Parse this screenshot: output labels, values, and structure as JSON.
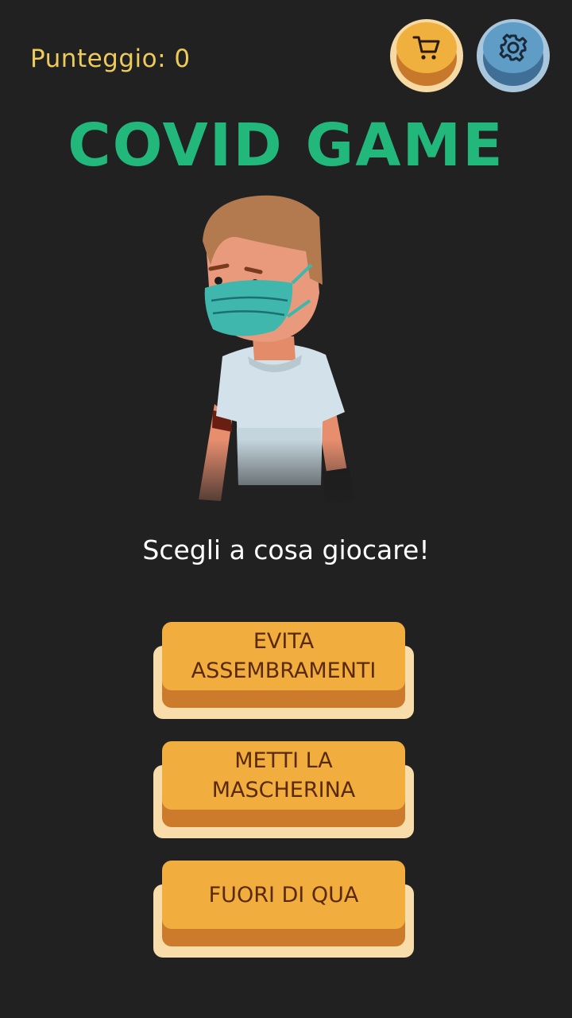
{
  "hud": {
    "score_text": "Punteggio: 0",
    "shop_icon": "cart-icon",
    "settings_icon": "gear-icon"
  },
  "title": "COVID GAME",
  "subtitle": "Scegli a cosa giocare!",
  "menu": {
    "buttons": [
      {
        "label_line1": "EVITA",
        "label_line2": "ASSEMBRAMENTI"
      },
      {
        "label_line1": "METTI LA",
        "label_line2": "MASCHERINA"
      },
      {
        "label_line1": "FUORI DI QUA",
        "label_line2": ""
      }
    ]
  },
  "colors": {
    "background": "#212121",
    "score": "#eccb5a",
    "title": "#22b77b",
    "button_face": "#f1ad3e",
    "button_text": "#5a2a08",
    "shop_button": "#f0b03d",
    "settings_button": "#5f9cc6"
  }
}
